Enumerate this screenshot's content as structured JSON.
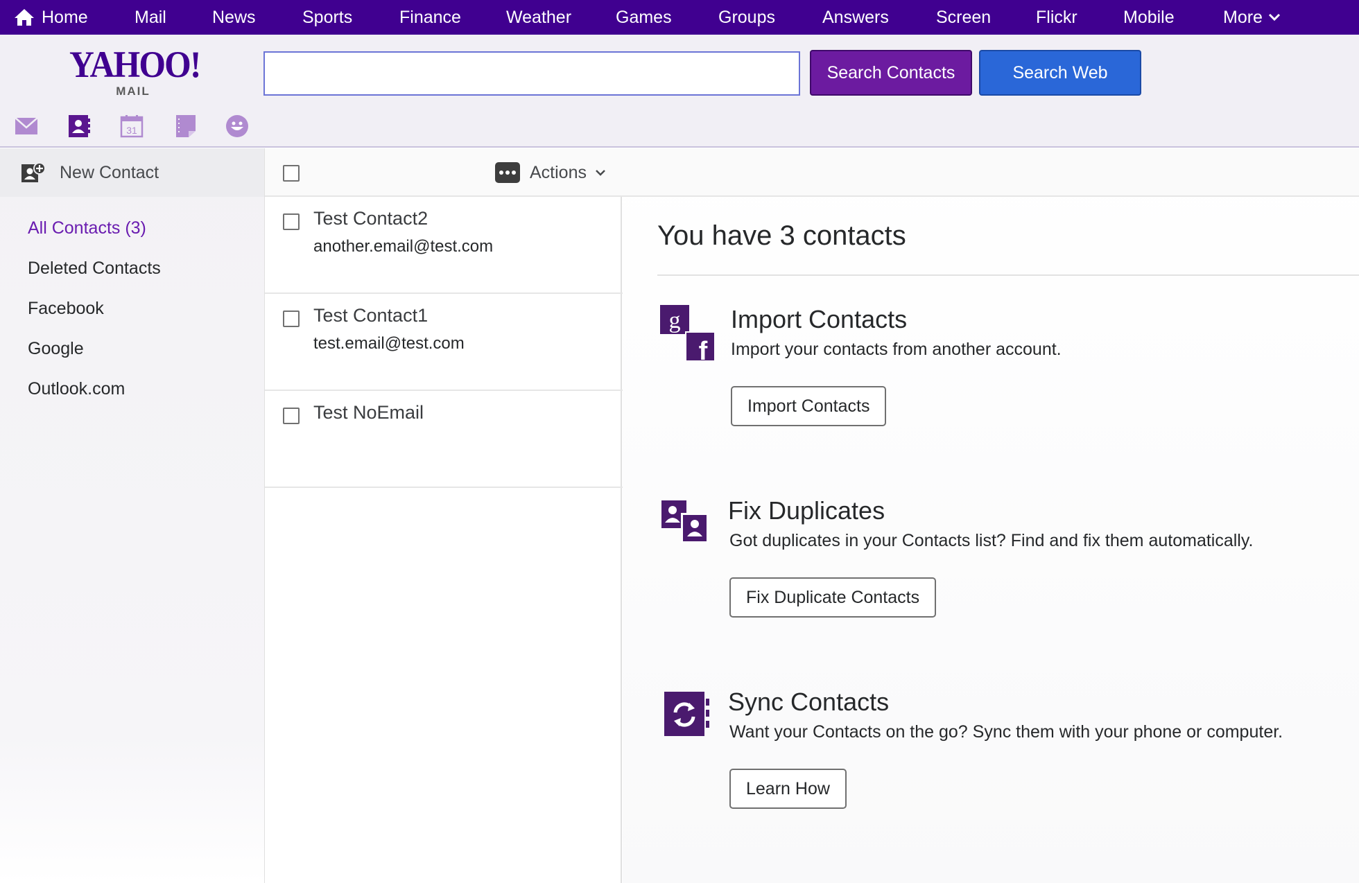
{
  "topnav": {
    "items": [
      {
        "label": "Home",
        "icon": "home-icon"
      },
      {
        "label": "Mail"
      },
      {
        "label": "News"
      },
      {
        "label": "Sports"
      },
      {
        "label": "Finance"
      },
      {
        "label": "Weather"
      },
      {
        "label": "Games"
      },
      {
        "label": "Groups"
      },
      {
        "label": "Answers"
      },
      {
        "label": "Screen"
      },
      {
        "label": "Flickr"
      },
      {
        "label": "Mobile"
      },
      {
        "label": "More",
        "icon": "chevron-down-icon"
      }
    ]
  },
  "header": {
    "logo_text": "YAHOO!",
    "logo_sub": "MAIL",
    "search_value": "",
    "search_contacts_label": "Search Contacts",
    "search_web_label": "Search Web",
    "app_icons": [
      "mail-icon",
      "contacts-icon",
      "calendar-icon",
      "notepad-icon",
      "messenger-icon"
    ],
    "calendar_day": "31"
  },
  "sidebar": {
    "new_contact_label": "New Contact",
    "items": [
      {
        "label": "All Contacts (3)",
        "active": true
      },
      {
        "label": "Deleted Contacts"
      },
      {
        "label": "Facebook"
      },
      {
        "label": "Google"
      },
      {
        "label": "Outlook.com"
      }
    ]
  },
  "list": {
    "actions_label": "Actions",
    "contacts": [
      {
        "name": "Test Contact2",
        "email": "another.email@test.com"
      },
      {
        "name": "Test Contact1",
        "email": "test.email@test.com"
      },
      {
        "name": "Test NoEmail",
        "email": ""
      }
    ]
  },
  "main": {
    "summary_title": "You have 3 contacts",
    "features": [
      {
        "title": "Import Contacts",
        "description": "Import your contacts from another account.",
        "button": "Import Contacts",
        "icon": "import-google-facebook-icon"
      },
      {
        "title": "Fix Duplicates",
        "description": "Got duplicates in your Contacts list? Find and fix them automatically.",
        "button": "Fix Duplicate Contacts",
        "icon": "duplicates-icon"
      },
      {
        "title": "Sync Contacts",
        "description": "Want your Contacts on the go? Sync them with your phone or computer.",
        "button": "Learn How",
        "icon": "sync-icon"
      }
    ]
  },
  "colors": {
    "brand_purple": "#400090",
    "search_contacts_bg": "#6c1ba0",
    "search_web_bg": "#2a67d8",
    "active_link": "#6a1cb0"
  }
}
